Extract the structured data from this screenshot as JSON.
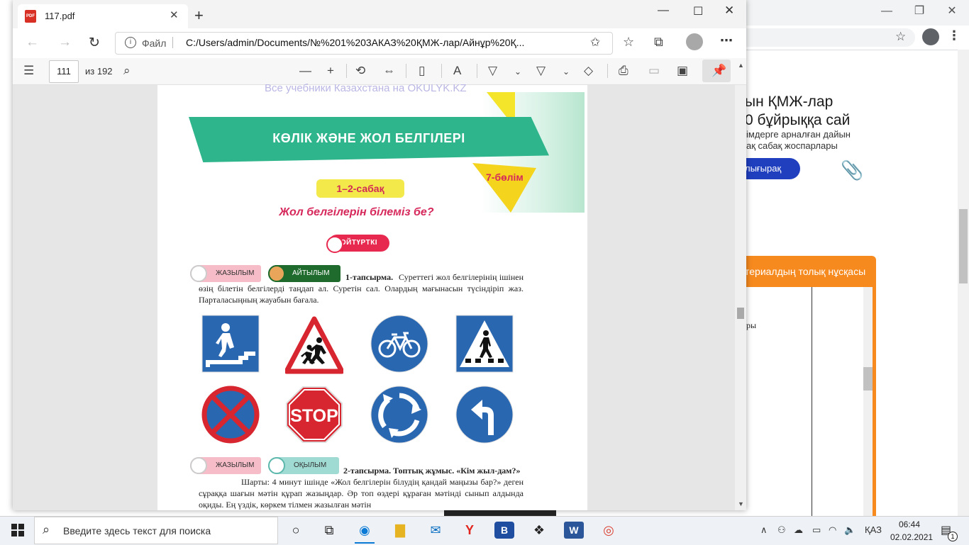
{
  "background_window": {
    "ad_line1": "ын ҚМЖ-лар",
    "ad_line2": "0 бұйрыққа сай",
    "ad_line3": "імдерге арналған дайын",
    "ad_line4": "ақ сабақ жоспарлары",
    "ad_button": "лығырақ",
    "orange_header": "териалдың толық нұсқасы",
    "panel_text": "ры"
  },
  "browser": {
    "tab_title": "117.pdf",
    "pdf_badge": "PDF",
    "file_label": "Файл",
    "url": "C:/Users/admin/Documents/№%201%203АКАЗ%20ҚМЖ-лар/Айнұр%20Қ..."
  },
  "pdf_toolbar": {
    "page_current": "111",
    "page_total": "из 192"
  },
  "page": {
    "watermark": "Все учебники Казахстана на OKULYK.KZ",
    "banner_title": "КӨЛІК ЖӘНЕ ЖОЛ БЕЛГІЛЕРІ",
    "section": "7-бөлім",
    "lesson": "1–2-сабақ",
    "lesson_title": "Жол белгілерін білеміз бе?",
    "oyturtki": "ОЙТҮРТКІ",
    "tag_zhazylym": "ЖАЗЫЛЫМ",
    "tag_aitylym": "АЙТЫЛЫМ",
    "tag_zhazylym2": "ЖАЗЫЛЫМ",
    "tag_oqylym": "ОҚЫЛЫМ",
    "task1_label": "1-тапсырма.",
    "task1_text": "Суреттегі жол белгілерінің ішінен өзің білетін белгілерді таңдап ал. Суретін сал. Олардың мағынасын түсіндіріп жаз. Парталасыңның жауабын бағала.",
    "stop_text": "STOP",
    "task2_label": "2-тапсырма. Топтық жұмыс. «Кім жыл-дам?»",
    "task2_text": "Шарты: 4 минут ішінде «Жол белгілерін білудің қандай маңызы бар?» деген сұраққа шағын мәтін құрап жазыңдар. Әр топ өздері құраған мәтінді сынып алдында оқиды. Ең үздік, көркем тілмен жазылған мәтін"
  },
  "taskbar": {
    "search_placeholder": "Введите здесь текст для поиска",
    "lang": "ҚАЗ",
    "time": "06:44",
    "date": "02.02.2021",
    "notif_count": "1"
  },
  "colors": {
    "banner_green": "#2fb58b",
    "accent_pink": "#d6285a",
    "sign_blue": "#2a67b1",
    "sign_red": "#d7262f"
  }
}
